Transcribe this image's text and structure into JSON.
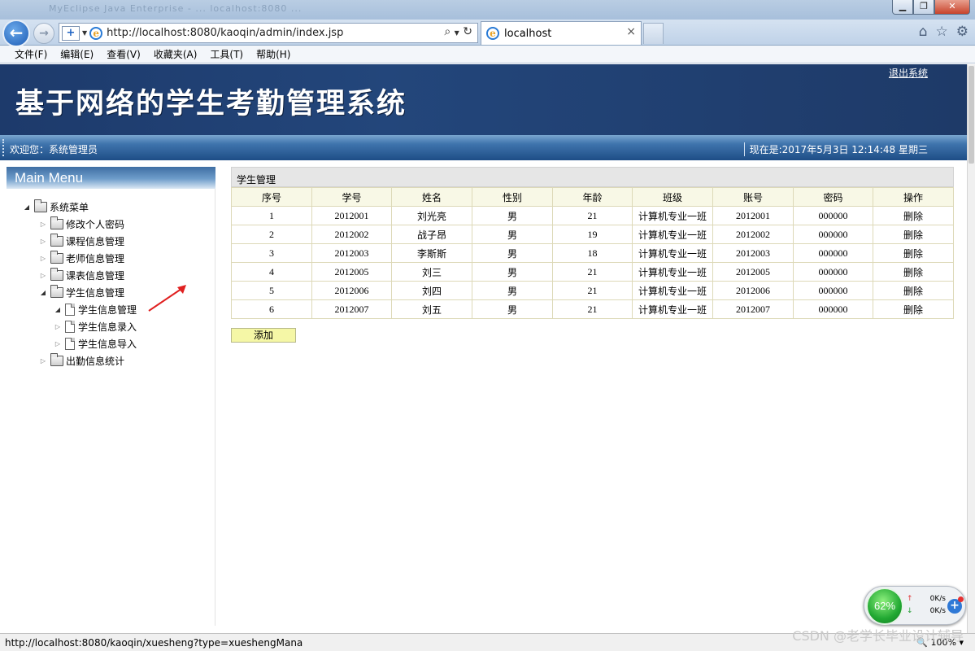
{
  "browser": {
    "window_title_ghost": "MyEclipse Java Enterprise - ... localhost:8080 ...",
    "url": "http://localhost:8080/kaoqin/admin/index.jsp",
    "tab_title": "localhost",
    "tab_close": "×",
    "menu": [
      "文件(F)",
      "编辑(E)",
      "查看(V)",
      "收藏夹(A)",
      "工具(T)",
      "帮助(H)"
    ],
    "status_url": "http://localhost:8080/kaoqin/xuesheng?type=xueshengMana",
    "zoom": "100%"
  },
  "header": {
    "system_title": "基于网络的学生考勤管理系统",
    "logout": "退出系统",
    "welcome": "欢迎您：系统管理员",
    "clock": "现在是:2017年5月3日 12:14:48 星期三"
  },
  "sidebar": {
    "heading": "Main Menu",
    "root": "系统菜单",
    "items": [
      {
        "label": "修改个人密码"
      },
      {
        "label": "课程信息管理"
      },
      {
        "label": "老师信息管理"
      },
      {
        "label": "课表信息管理"
      },
      {
        "label": "学生信息管理"
      },
      {
        "label": "出勤信息统计"
      }
    ],
    "subitems": [
      {
        "label": "学生信息管理"
      },
      {
        "label": "学生信息录入"
      },
      {
        "label": "学生信息导入"
      }
    ]
  },
  "main": {
    "panel_title": "学生管理",
    "columns": [
      "序号",
      "学号",
      "姓名",
      "性别",
      "年龄",
      "班级",
      "账号",
      "密码",
      "操作"
    ],
    "rows": [
      [
        "1",
        "2012001",
        "刘光亮",
        "男",
        "21",
        "计算机专业一班",
        "2012001",
        "000000",
        "删除"
      ],
      [
        "2",
        "2012002",
        "战子昂",
        "男",
        "19",
        "计算机专业一班",
        "2012002",
        "000000",
        "删除"
      ],
      [
        "3",
        "2012003",
        "李斯斯",
        "男",
        "18",
        "计算机专业一班",
        "2012003",
        "000000",
        "删除"
      ],
      [
        "4",
        "2012005",
        "刘三",
        "男",
        "21",
        "计算机专业一班",
        "2012005",
        "000000",
        "删除"
      ],
      [
        "5",
        "2012006",
        "刘四",
        "男",
        "21",
        "计算机专业一班",
        "2012006",
        "000000",
        "删除"
      ],
      [
        "6",
        "2012007",
        "刘五",
        "男",
        "21",
        "计算机专业一班",
        "2012007",
        "000000",
        "删除"
      ]
    ],
    "add_button": "添加"
  },
  "net_widget": {
    "percent": "62%",
    "up": "0K/s",
    "down": "0K/s"
  },
  "watermark": "CSDN @老学长毕业设计辅导",
  "colors": {
    "banner": "#1d3a6b",
    "welcome_bar": "#2a5b94",
    "table_border": "#ddd9b8",
    "table_header": "#f8f8e6",
    "add_button": "#f5f7a6"
  }
}
